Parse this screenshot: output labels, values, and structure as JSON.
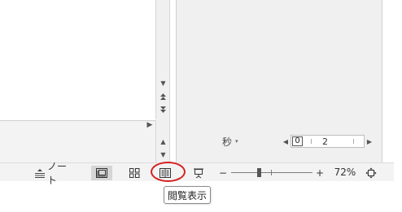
{
  "status_bar": {
    "notes_label": "ノート",
    "zoom_minus": "−",
    "zoom_plus": "+",
    "zoom_level": "72%",
    "zoom_fraction": 0.72
  },
  "section_dropdown": {
    "label": "秒",
    "caret": "▾"
  },
  "slide_pager": {
    "prev": "◀",
    "next": "▶",
    "current": "0",
    "value": "2"
  },
  "scroll_glyphs": {
    "down": "▼",
    "up": "▲",
    "prev_slide": "▲",
    "next_slide": "▼",
    "right": "▶"
  },
  "tooltip": {
    "text": "閲覧表示"
  },
  "colors": {
    "highlight_circle": "#d62020",
    "status_bar_bg": "#f3f3f3",
    "active_view_bg": "#d6d6d6"
  },
  "icons": {
    "notes": "notes-icon",
    "normal_view": "normal-view-icon",
    "slide_sorter": "slide-sorter-icon",
    "reading_view": "reading-view-icon",
    "slideshow": "slideshow-icon",
    "fit_to_window": "fit-to-window-icon"
  }
}
